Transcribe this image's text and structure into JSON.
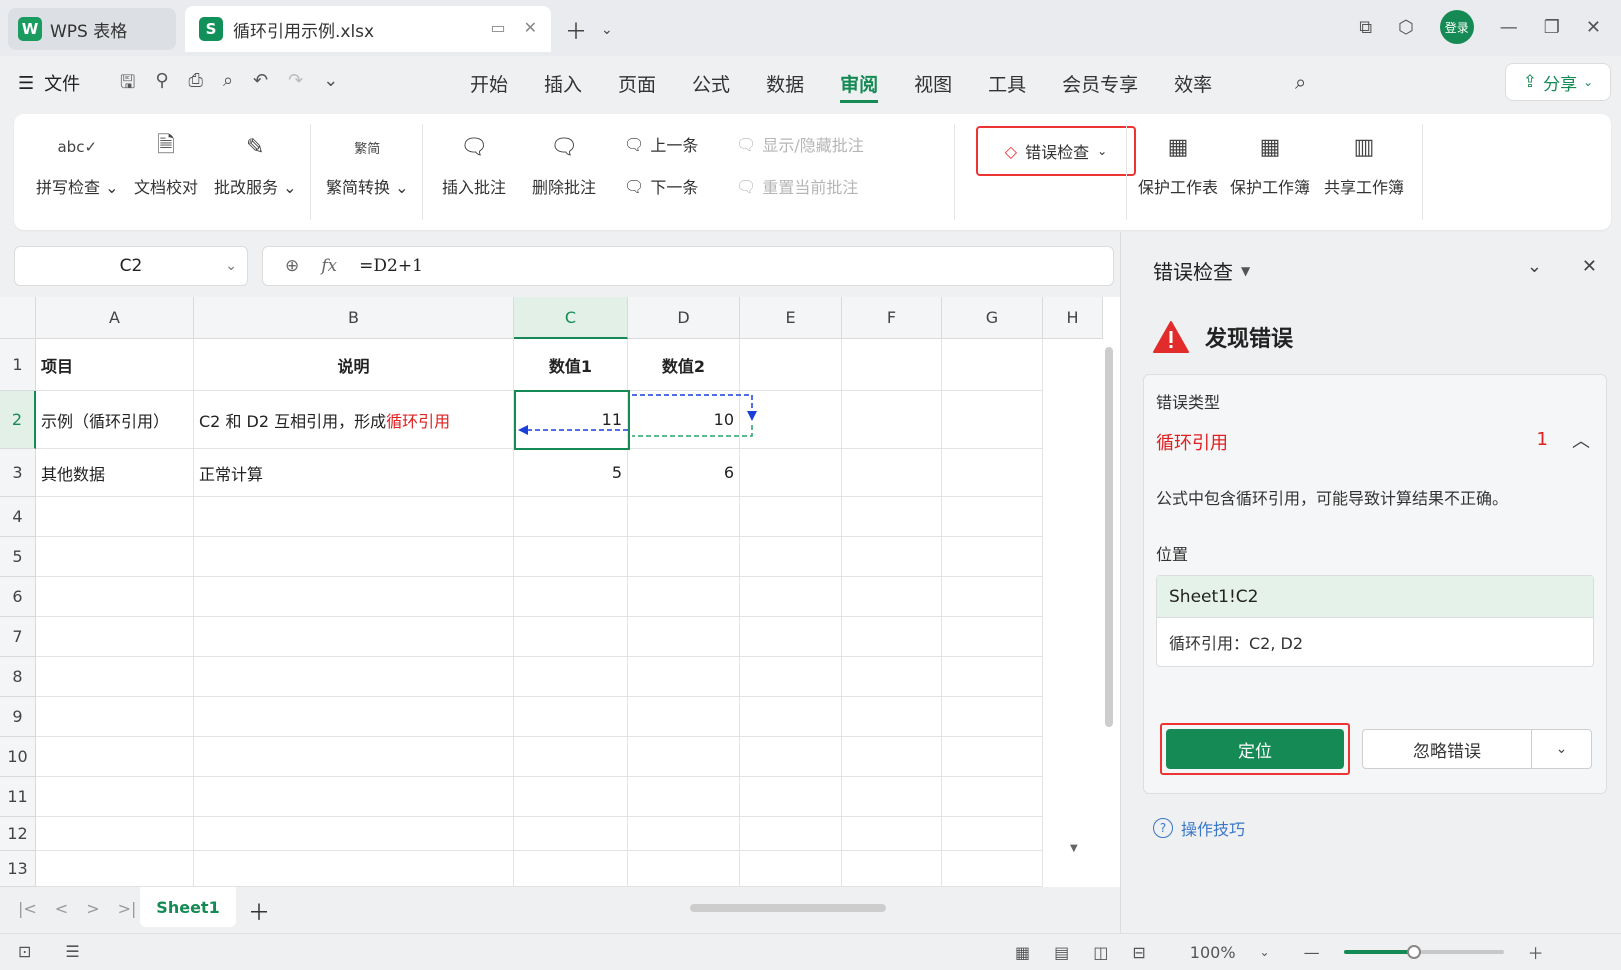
{
  "app": {
    "name": "WPS 表格",
    "file_tab": "循环引用示例.xlsx"
  },
  "titlebar": {
    "login": "登录"
  },
  "menu": {
    "file": "文件",
    "tabs": [
      "开始",
      "插入",
      "页面",
      "公式",
      "数据",
      "审阅",
      "视图",
      "工具",
      "会员专享",
      "效率"
    ],
    "active_tab": "审阅",
    "share": "分享"
  },
  "ribbon": {
    "spell_check": "拼写检查",
    "doc_proof": "文档校对",
    "correction": "批改服务",
    "trad_simp": "繁简转换",
    "insert_comment": "插入批注",
    "delete_comment": "删除批注",
    "prev": "上一条",
    "next": "下一条",
    "show_hide_comment": "显示/隐藏批注",
    "reset_comment": "重置当前批注",
    "error_check": "错误检查",
    "protect_sheet": "保护工作表",
    "protect_book": "保护工作簿",
    "share_book": "共享工作簿"
  },
  "formula": {
    "cell_ref": "C2",
    "fx": "fx",
    "content": "=D2+1"
  },
  "grid": {
    "columns": [
      "A",
      "B",
      "C",
      "D",
      "E",
      "F",
      "G",
      "H"
    ],
    "rows": [
      "1",
      "2",
      "3",
      "4",
      "5",
      "6",
      "7",
      "8",
      "9",
      "10",
      "11",
      "12",
      "13"
    ],
    "cells": {
      "A1": "项目",
      "B1": "说明",
      "C1": "数值1",
      "D1": "数值2",
      "A2": "示例（循环引用）",
      "B2_normal": "C2 和 D2 互相引用，形成",
      "B2_red": "循环引用",
      "C2": "11",
      "D2": "10",
      "A3": "其他数据",
      "B3": "正常计算",
      "C3": "5",
      "D3": "6"
    }
  },
  "sheets": {
    "active": "Sheet1"
  },
  "status": {
    "zoom": "100%",
    "zoom_level": 0.44
  },
  "panel": {
    "title": "错误检查",
    "found": "发现错误",
    "type_label": "错误类型",
    "type_value": "循环引用",
    "count": "1",
    "description": "公式中包含循环引用，可能导致计算结果不正确。",
    "location_label": "位置",
    "location": "Sheet1!C2",
    "detail": "循环引用：C2, D2",
    "locate": "定位",
    "ignore": "忽略错误",
    "tips": "操作技巧"
  },
  "colors": {
    "accent": "#168a55",
    "error": "#e02020",
    "link": "#3a77c8"
  }
}
